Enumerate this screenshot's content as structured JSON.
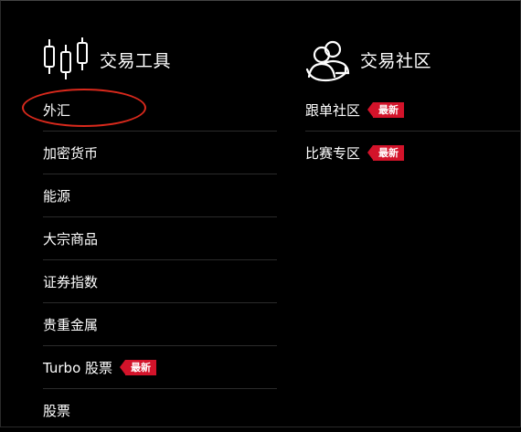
{
  "trading_tools": {
    "title": "交易工具",
    "icon": "candlestick-icon",
    "items": [
      {
        "label": "外汇",
        "badge": ""
      },
      {
        "label": "加密货币",
        "badge": ""
      },
      {
        "label": "能源",
        "badge": ""
      },
      {
        "label": "大宗商品",
        "badge": ""
      },
      {
        "label": "证券指数",
        "badge": ""
      },
      {
        "label": "贵重金属",
        "badge": ""
      },
      {
        "label": "Turbo 股票",
        "badge": "最新"
      },
      {
        "label": "股票",
        "badge": ""
      }
    ]
  },
  "trading_community": {
    "title": "交易社区",
    "icon": "community-users-icon",
    "items": [
      {
        "label": "跟单社区",
        "badge": "最新"
      },
      {
        "label": "比赛专区",
        "badge": "最新"
      }
    ]
  },
  "colors": {
    "background": "#000000",
    "text": "#ffffff",
    "badge": "#d3132a",
    "highlight": "#d9291c",
    "divider": "#2b2b2b"
  }
}
